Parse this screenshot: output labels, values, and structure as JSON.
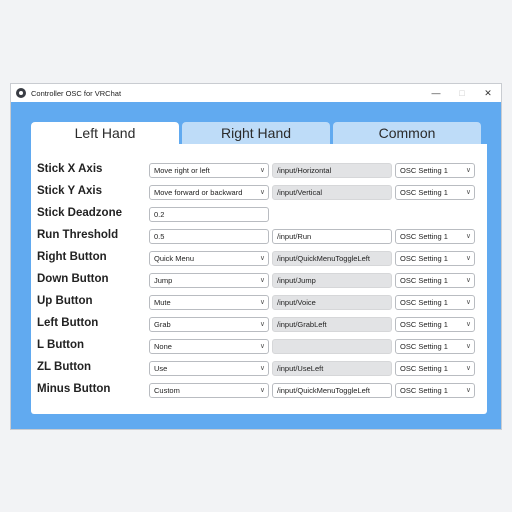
{
  "window": {
    "title": "Controller OSC for VRChat",
    "minimize": "—",
    "maximize": "□",
    "close": "✕"
  },
  "tabs": [
    {
      "label": "Left Hand",
      "active": true
    },
    {
      "label": "Right Hand",
      "active": false
    },
    {
      "label": "Common",
      "active": false
    }
  ],
  "rows": [
    {
      "label": "Stick X Axis",
      "action": "Move right or left",
      "path": "/input/Horizontal",
      "osc": "OSC Setting 1"
    },
    {
      "label": "Stick Y Axis",
      "action": "Move forward or backward",
      "path": "/input/Vertical",
      "osc": "OSC Setting 1"
    },
    {
      "label": "Stick Deadzone",
      "value": "0.2"
    },
    {
      "label": "Run Threshold",
      "value": "0.5",
      "path": "/input/Run",
      "osc": "OSC Setting 1"
    },
    {
      "label": "Right Button",
      "action": "Quick Menu",
      "path": "/input/QuickMenuToggleLeft",
      "osc": "OSC Setting 1"
    },
    {
      "label": "Down Button",
      "action": "Jump",
      "path": "/input/Jump",
      "osc": "OSC Setting 1"
    },
    {
      "label": "Up Button",
      "action": "Mute",
      "path": "/input/Voice",
      "osc": "OSC Setting 1"
    },
    {
      "label": "Left Button",
      "action": "Grab",
      "path": "/input/GrabLeft",
      "osc": "OSC Setting 1"
    },
    {
      "label": "L Button",
      "action": "None",
      "path": "",
      "osc": "OSC Setting 1"
    },
    {
      "label": "ZL Button",
      "action": "Use",
      "path": "/input/UseLeft",
      "osc": "OSC Setting 1"
    },
    {
      "label": "Minus Button",
      "action": "Custom",
      "path": "/input/QuickMenuToggleLeft",
      "osc": "OSC Setting 1"
    }
  ],
  "colors": {
    "accent": "#61aaf0",
    "tab_inactive": "#bedcf8",
    "readonly_field": "#e2e3e5"
  }
}
